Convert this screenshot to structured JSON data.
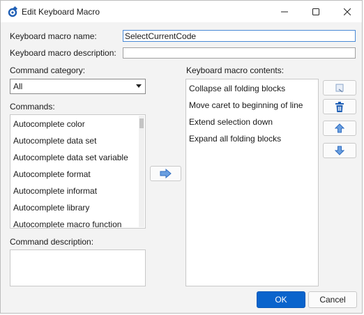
{
  "window": {
    "title": "Edit Keyboard Macro",
    "icon": "gear-wrench-icon",
    "accent": "#0a64cc"
  },
  "form": {
    "name_label": "Keyboard macro name:",
    "name_value": "SelectCurrentCode",
    "description_label": "Keyboard macro description:",
    "description_value": "",
    "category_label": "Command category:",
    "category_value": "All",
    "commands_label": "Commands:",
    "contents_label": "Keyboard macro contents:",
    "command_description_label": "Command description:"
  },
  "commands": [
    "Autocomplete color",
    "Autocomplete data set",
    "Autocomplete data set variable",
    "Autocomplete format",
    "Autocomplete informat",
    "Autocomplete library",
    "Autocomplete macro function"
  ],
  "contents": [
    "Collapse all folding blocks",
    "Move caret to beginning of line",
    "Extend selection down",
    "Expand all folding blocks"
  ],
  "buttons": {
    "ok": "OK",
    "cancel": "Cancel"
  }
}
